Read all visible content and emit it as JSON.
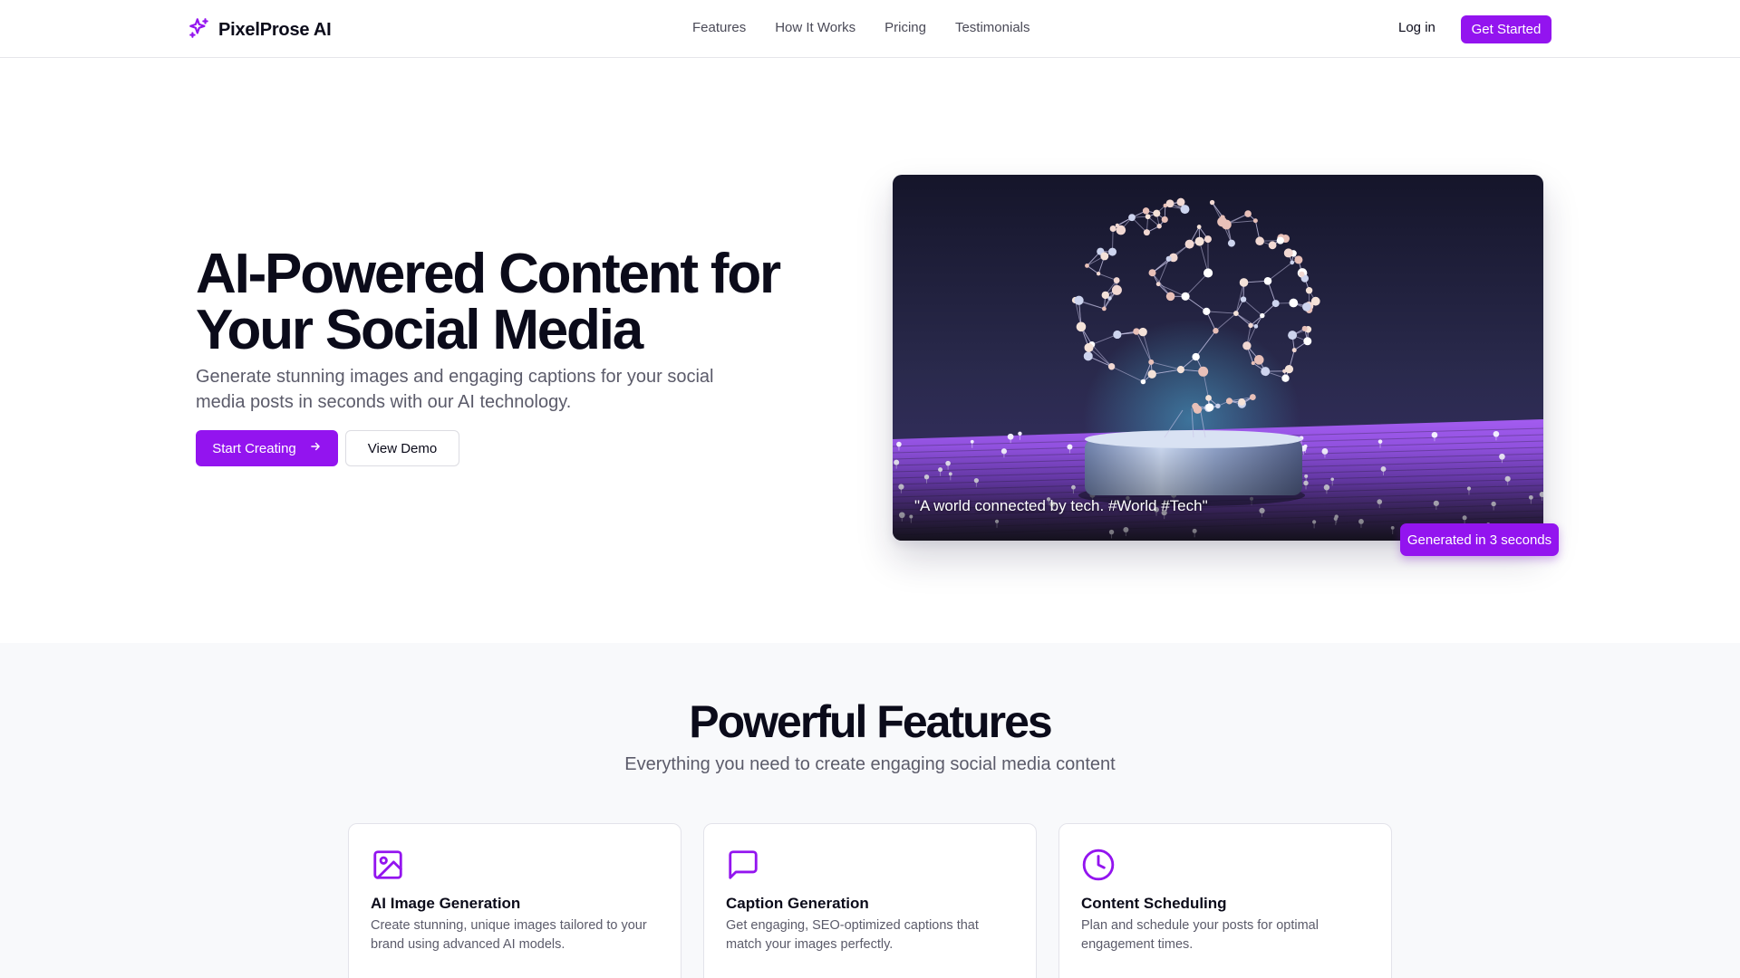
{
  "brand": {
    "name": "PixelProse AI",
    "accent": "#9314ef"
  },
  "nav": {
    "links": [
      "Features",
      "How It Works",
      "Pricing",
      "Testimonials"
    ],
    "login": "Log in",
    "get_started": "Get Started"
  },
  "hero": {
    "title": "AI-Powered Content for Your Social Media",
    "subtitle": "Generate stunning images and engaging captions for your social media posts in seconds with our AI technology.",
    "primary_button": "Start Creating",
    "secondary_button": "View Demo",
    "image_caption": "\"A world connected by tech. #World #Tech\"",
    "badge": "Generated in 3 seconds"
  },
  "features": {
    "title": "Powerful Features",
    "subtitle": "Everything you need to create engaging social media content",
    "cards": [
      {
        "icon": "image-icon",
        "title": "AI Image Generation",
        "description": "Create stunning, unique images tailored to your brand using advanced AI models."
      },
      {
        "icon": "message-square-icon",
        "title": "Caption Generation",
        "description": "Get engaging, SEO-optimized captions that match your images perfectly."
      },
      {
        "icon": "clock-icon",
        "title": "Content Scheduling",
        "description": "Plan and schedule your posts for optimal engagement times."
      }
    ]
  }
}
